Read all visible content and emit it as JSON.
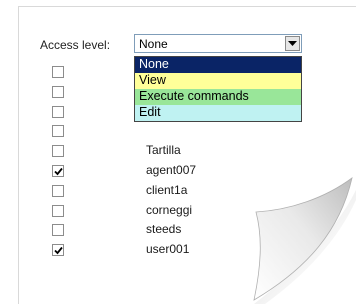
{
  "access": {
    "label": "Access level:",
    "selected": "None",
    "options": [
      {
        "label": "None",
        "bg": "#0a2466",
        "fg": "#ffffff"
      },
      {
        "label": "View",
        "bg": "#ffff99",
        "fg": "#000000"
      },
      {
        "label": "Execute commands",
        "bg": "#99e699",
        "fg": "#000000"
      },
      {
        "label": "Edit",
        "bg": "#bff2f2",
        "fg": "#000000"
      }
    ]
  },
  "users": [
    {
      "name": "",
      "checked": false
    },
    {
      "name": "",
      "checked": false
    },
    {
      "name": "",
      "checked": false
    },
    {
      "name": "",
      "checked": false
    },
    {
      "name": "Tartilla",
      "checked": false
    },
    {
      "name": "agent007",
      "checked": true
    },
    {
      "name": "client1a",
      "checked": false
    },
    {
      "name": "corneggi",
      "checked": false
    },
    {
      "name": "steeds",
      "checked": false
    },
    {
      "name": "user001",
      "checked": true
    }
  ]
}
